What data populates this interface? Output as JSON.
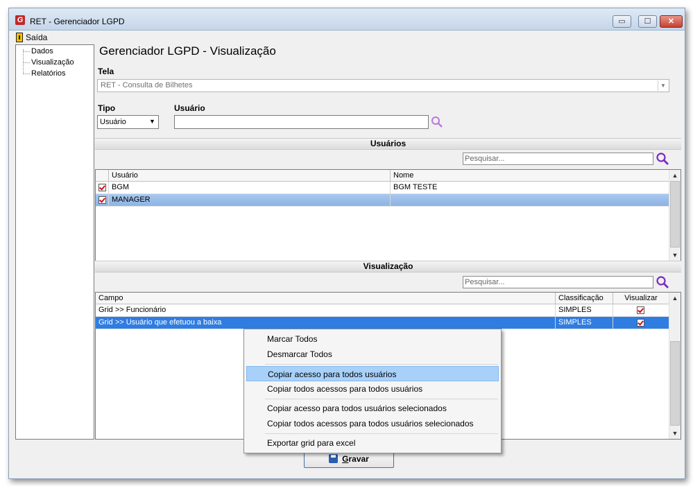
{
  "window": {
    "title": "RET - Gerenciador LGPD",
    "icon_letter": "G"
  },
  "titlebar": {
    "min": "▭",
    "max": "☐",
    "close": "✕"
  },
  "menu": {
    "exit_label": "Saída"
  },
  "tree": {
    "items": [
      "Dados",
      "Visualização",
      "Relatórios"
    ]
  },
  "page": {
    "title": "Gerenciador LGPD - Visualização"
  },
  "tela": {
    "label": "Tela",
    "value": "RET - Consulta de Bilhetes"
  },
  "tipo": {
    "label": "Tipo",
    "value": "Usuário"
  },
  "usuario": {
    "label": "Usuário",
    "value": ""
  },
  "usuarios_section": {
    "header": "Usuários",
    "search_placeholder": "Pesquisar...",
    "columns": [
      "Usuário",
      "Nome"
    ],
    "rows": [
      {
        "usuario": "BGM",
        "nome": "BGM TESTE",
        "checked": true
      },
      {
        "usuario": "MANAGER",
        "nome": "",
        "checked": true
      }
    ]
  },
  "visualizacao_section": {
    "header": "Visualização",
    "search_placeholder": "Pesquisar...",
    "columns": [
      "Campo",
      "Classificação",
      "Visualizar"
    ],
    "rows": [
      {
        "campo": "Grid >> Funcionário",
        "classificacao": "SIMPLES",
        "visualizar": true
      },
      {
        "campo": "Grid >> Usuário que efetuou a baixa",
        "classificacao": "SIMPLES",
        "visualizar": true
      }
    ]
  },
  "context_menu": {
    "items": [
      "Marcar Todos",
      "Desmarcar Todos",
      "Copiar acesso para todos usuários",
      "Copiar todos acessos para todos usuários",
      "Copiar acesso para todos usuários selecionados",
      "Copiar todos acessos para todos usuários selecionados",
      "Exportar grid para excel"
    ],
    "highlighted_index": 2
  },
  "footer": {
    "save_label_underlined": "G",
    "save_label_rest": "ravar"
  },
  "colors": {
    "selection": "#2f7de1",
    "accent_search": "#7a2bbf",
    "check": "#cc1010"
  }
}
